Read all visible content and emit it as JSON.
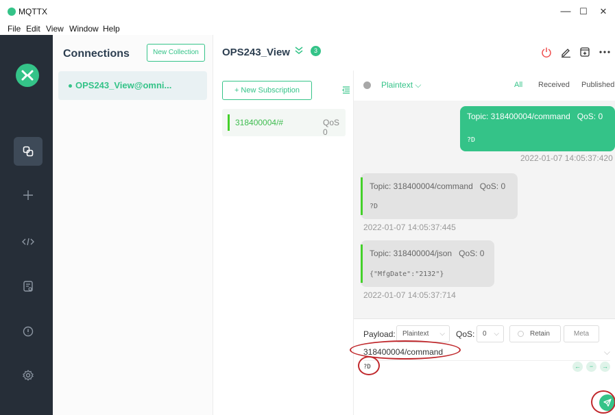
{
  "window": {
    "title": "MQTTX",
    "minimize_glyph": "—",
    "maximize_glyph": "☐",
    "close_glyph": "✕"
  },
  "menu": [
    "File",
    "Edit",
    "View",
    "Window",
    "Help"
  ],
  "sidebar": {
    "items": [
      {
        "icon": "connections-icon",
        "active": true
      },
      {
        "icon": "plus-icon",
        "active": false
      },
      {
        "icon": "script-icon",
        "active": false
      },
      {
        "icon": "log-icon",
        "active": false
      },
      {
        "icon": "info-icon",
        "active": false
      },
      {
        "icon": "settings-icon",
        "active": false
      }
    ]
  },
  "connections_panel": {
    "title": "Connections",
    "new_collection_label": "New Collection",
    "items": [
      {
        "name": "OPS243_View@omni...",
        "status": "connected"
      }
    ]
  },
  "connection_header": {
    "title": "OPS243_View",
    "subscription_count": "3"
  },
  "subscriptions": {
    "new_label": "+ New Subscription",
    "items": [
      {
        "topic": "318400004/#",
        "qos": "QoS 0"
      }
    ]
  },
  "message_toolbar": {
    "format": "Plaintext",
    "tabs": [
      "All",
      "Received",
      "Published"
    ],
    "active_tab": "All"
  },
  "messages": [
    {
      "direction": "out",
      "topic": "Topic: 318400004/command",
      "qos": "QoS: 0",
      "payload": "?D",
      "time": "2022-01-07 14:05:37:420"
    },
    {
      "direction": "in",
      "topic": "Topic: 318400004/command",
      "qos": "QoS: 0",
      "payload": "?D",
      "time": "2022-01-07 14:05:37:445"
    },
    {
      "direction": "in",
      "topic": "Topic: 318400004/json",
      "qos": "QoS: 0",
      "payload": "{\"MfgDate\":\"2132\"}",
      "time": "2022-01-07 14:05:37:714"
    }
  ],
  "compose": {
    "payload_label": "Payload:",
    "payload_format": "Plaintext",
    "qos_label": "QoS:",
    "qos_value": "0",
    "retain_label": "Retain",
    "meta_label": "Meta",
    "topic": "318400004/command",
    "payload": "?D"
  },
  "colors": {
    "accent": "#34c388",
    "sidebar_bg": "#262e38",
    "annotation": "#c0282c"
  }
}
